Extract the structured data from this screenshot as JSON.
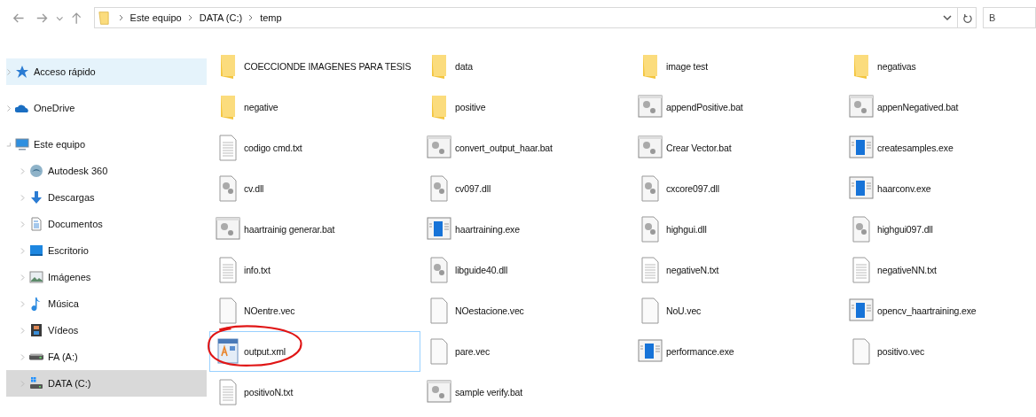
{
  "address_bar": {
    "path": [
      {
        "label": "Este equipo"
      },
      {
        "label": "DATA (C:)"
      },
      {
        "label": "temp"
      }
    ]
  },
  "search": {
    "placeholder": "B"
  },
  "sidebar": {
    "items": [
      {
        "label": "Acceso rápido",
        "kind": "star",
        "highlighted": true,
        "selected": false,
        "expanded": false
      },
      {
        "label": "OneDrive",
        "kind": "cloud",
        "highlighted": false,
        "selected": false,
        "expanded": false
      },
      {
        "label": "Este equipo",
        "kind": "pc",
        "highlighted": false,
        "selected": false,
        "expanded": true,
        "children": [
          {
            "label": "Autodesk 360",
            "kind": "autodesk",
            "highlighted": false,
            "selected": false,
            "expanded": false
          },
          {
            "label": "Descargas",
            "kind": "download",
            "highlighted": false,
            "selected": false,
            "expanded": false
          },
          {
            "label": "Documentos",
            "kind": "docs",
            "highlighted": false,
            "selected": false,
            "expanded": false
          },
          {
            "label": "Escritorio",
            "kind": "desktop",
            "highlighted": false,
            "selected": false,
            "expanded": false
          },
          {
            "label": "Imágenes",
            "kind": "images",
            "highlighted": false,
            "selected": false,
            "expanded": false
          },
          {
            "label": "Música",
            "kind": "music",
            "highlighted": false,
            "selected": false,
            "expanded": false
          },
          {
            "label": "Vídeos",
            "kind": "videos",
            "highlighted": false,
            "selected": false,
            "expanded": false
          },
          {
            "label": "FA (A:)",
            "kind": "drive",
            "highlighted": false,
            "selected": false,
            "expanded": false
          },
          {
            "label": "DATA (C:)",
            "kind": "windrive",
            "highlighted": false,
            "selected": true,
            "expanded": false
          }
        ]
      }
    ]
  },
  "files": [
    {
      "name": "COECCIONDE IMAGENES PARA TESIS",
      "kind": "folder",
      "selected": false
    },
    {
      "name": "data",
      "kind": "folder",
      "selected": false
    },
    {
      "name": "image test",
      "kind": "folder",
      "selected": false
    },
    {
      "name": "negativas",
      "kind": "folder",
      "selected": false
    },
    {
      "name": "negative",
      "kind": "folder",
      "selected": false
    },
    {
      "name": "positive",
      "kind": "folder",
      "selected": false
    },
    {
      "name": "appendPositive.bat",
      "kind": "bat",
      "selected": false
    },
    {
      "name": "appenNegatived.bat",
      "kind": "bat",
      "selected": false
    },
    {
      "name": "codigo cmd.txt",
      "kind": "txt",
      "selected": false
    },
    {
      "name": "convert_output_haar.bat",
      "kind": "bat",
      "selected": false
    },
    {
      "name": "Crear Vector.bat",
      "kind": "bat",
      "selected": false
    },
    {
      "name": "createsamples.exe",
      "kind": "exe",
      "selected": false
    },
    {
      "name": "cv.dll",
      "kind": "dll",
      "selected": false
    },
    {
      "name": "cv097.dll",
      "kind": "dll",
      "selected": false
    },
    {
      "name": "cxcore097.dll",
      "kind": "dll",
      "selected": false
    },
    {
      "name": "haarconv.exe",
      "kind": "exe",
      "selected": false
    },
    {
      "name": "haartrainig generar.bat",
      "kind": "bat",
      "selected": false
    },
    {
      "name": "haartraining.exe",
      "kind": "exe",
      "selected": false
    },
    {
      "name": "highgui.dll",
      "kind": "dll",
      "selected": false
    },
    {
      "name": "highgui097.dll",
      "kind": "dll",
      "selected": false
    },
    {
      "name": "info.txt",
      "kind": "txt",
      "selected": false
    },
    {
      "name": "libguide40.dll",
      "kind": "dll",
      "selected": false
    },
    {
      "name": "negativeN.txt",
      "kind": "txt",
      "selected": false
    },
    {
      "name": "negativeNN.txt",
      "kind": "txt",
      "selected": false
    },
    {
      "name": "NOentre.vec",
      "kind": "blank",
      "selected": false
    },
    {
      "name": "NOestacione.vec",
      "kind": "blank",
      "selected": false
    },
    {
      "name": "NoU.vec",
      "kind": "blank",
      "selected": false
    },
    {
      "name": "opencv_haartraining.exe",
      "kind": "exe",
      "selected": false
    },
    {
      "name": "output.xml",
      "kind": "xml",
      "selected": true,
      "circled": true
    },
    {
      "name": "pare.vec",
      "kind": "blank",
      "selected": false
    },
    {
      "name": "performance.exe",
      "kind": "exe",
      "selected": false
    },
    {
      "name": "positivo.vec",
      "kind": "blank",
      "selected": false
    },
    {
      "name": "positivoN.txt",
      "kind": "txt",
      "selected": false
    },
    {
      "name": "sample verify.bat",
      "kind": "bat",
      "selected": false
    }
  ]
}
